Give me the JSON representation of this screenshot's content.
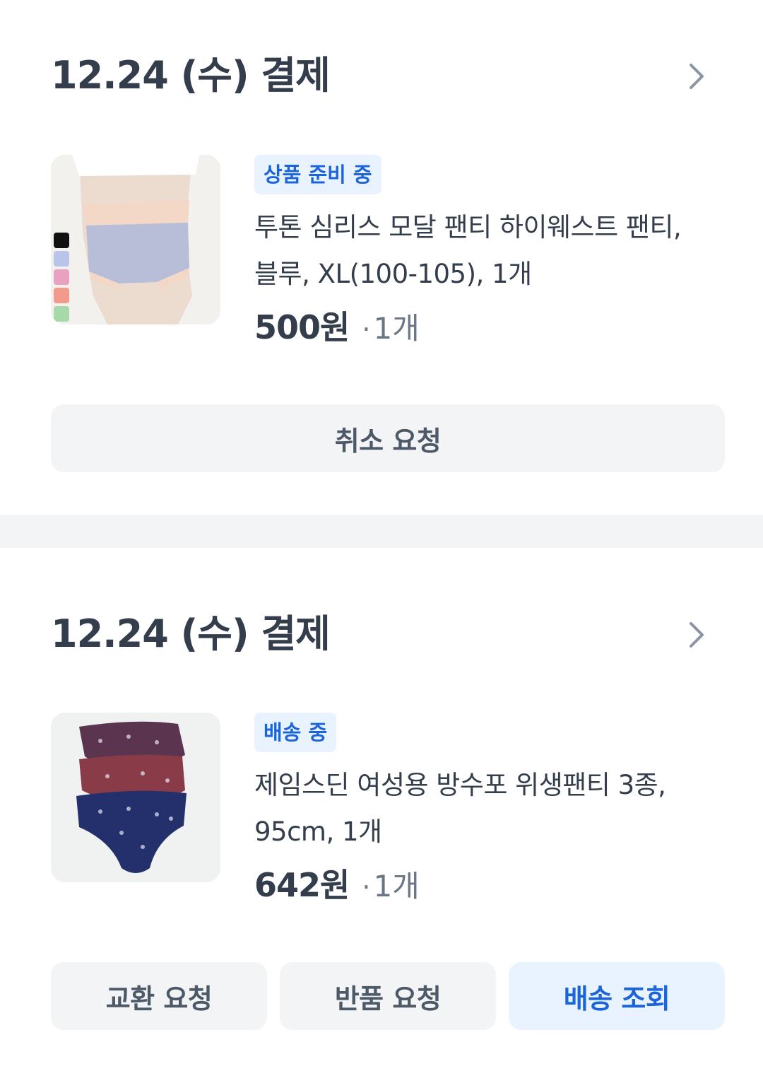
{
  "orders": [
    {
      "date_label": "12.24 (수) 결제",
      "status_badge": "상품 준비 중",
      "product_name": "투톤 심리스 모달 팬티 하이웨스트 팬티, 블루, XL(100-105), 1개",
      "price": "500원",
      "quantity": "1개",
      "buttons": [
        "취소 요청"
      ]
    },
    {
      "date_label": "12.24 (수) 결제",
      "status_badge": "배송 중",
      "product_name": "제임스딘 여성용 방수포 위생팬티 3종, 95cm, 1개",
      "price": "642원",
      "quantity": "1개",
      "buttons": [
        "교환 요청",
        "반품 요청",
        "배송 조회"
      ]
    }
  ],
  "colors": {
    "badge_bg": "#e8f3ff",
    "badge_text": "#1b64da",
    "button_bg": "#f2f4f6",
    "primary_button_text": "#1b64da",
    "section_divider": "#f2f4f6"
  },
  "icons": {
    "header_chevron": "chevron-right-icon"
  }
}
